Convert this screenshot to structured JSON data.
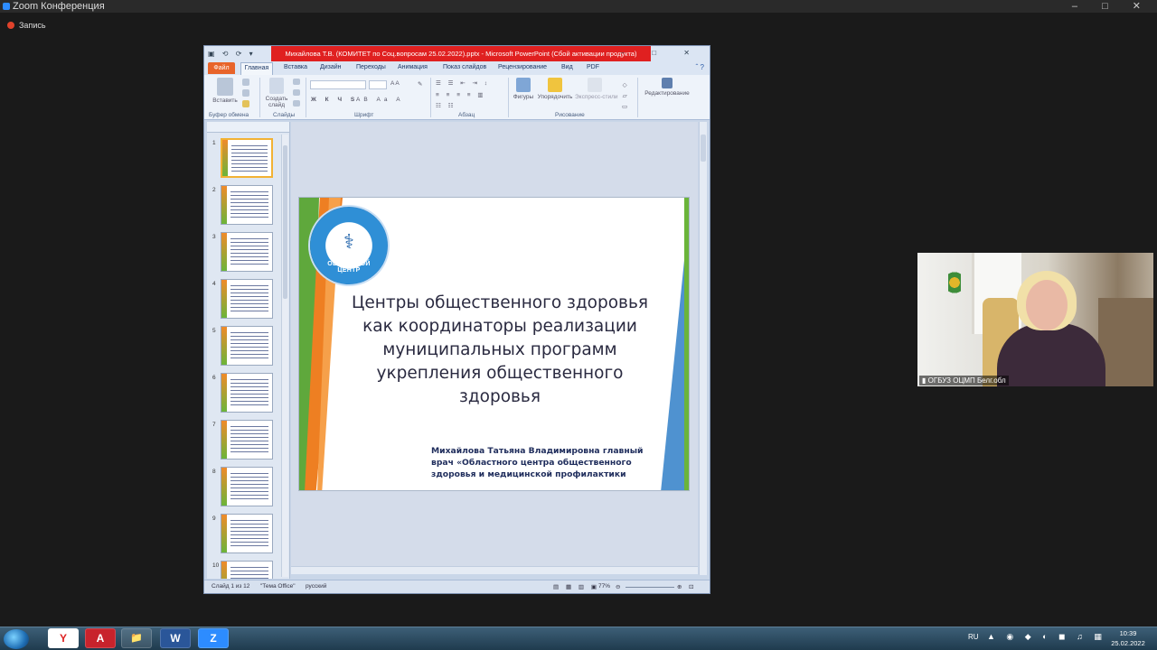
{
  "zoom": {
    "window_title": "Zoom Конференция",
    "recording_label": "Запись",
    "window_controls": "– □ ✕"
  },
  "ppt": {
    "title": "Михайлова Т.В.  (КОМИТЕТ по Соц.вопросам 25.02.2022).pptx - Microsoft PowerPoint (Сбой активации продукта)",
    "tabs": [
      "Файл",
      "Главная",
      "Вставка",
      "Дизайн",
      "Переходы",
      "Анимация",
      "Показ слайдов",
      "Рецензирование",
      "Вид",
      "PDF"
    ],
    "groups": {
      "clipboard": "Буфер обмена",
      "slides": "Слайды",
      "font": "Шрифт",
      "paragraph": "Абзац",
      "drawing": "Рисование"
    },
    "buttons": {
      "paste": "Вставить",
      "new_slide": "Создать слайд",
      "shapes": "Фигуры",
      "arrange": "Упорядочить",
      "quick_styles": "Экспресс-стили",
      "editing": "Редактирование"
    },
    "thumbnails": [
      1,
      2,
      3,
      4,
      5,
      6,
      7,
      8,
      9,
      10
    ],
    "status": {
      "slide": "Слайд 1 из 12",
      "theme": "\"Тема Office\"",
      "language": "русский",
      "zoom": "77%"
    }
  },
  "slide": {
    "logo_text": "ОБЛАСТНОЙ ЦЕНТР",
    "title": "Центры общественного здоровья как координаторы реализации муниципальных программ укрепления общественного здоровья",
    "author": "Михайлова Татьяна Владимировна главный врач «Областного центра общественного здоровья и медицинской профилактики"
  },
  "video": {
    "participant_label": "ОГБУЗ ОЦМП Белг.обл"
  },
  "taskbar": {
    "apps": [
      "Y",
      "A",
      "📁",
      "W",
      "Z"
    ],
    "lang": "RU",
    "time": "10:39",
    "date": "25.02.2022"
  },
  "colors": {
    "ppt_title_red": "#e02020",
    "file_tab": "#e8642a",
    "slide_orange": "#ee7f22",
    "slide_green": "#5fa83c",
    "slide_blue": "#4f92d0"
  }
}
